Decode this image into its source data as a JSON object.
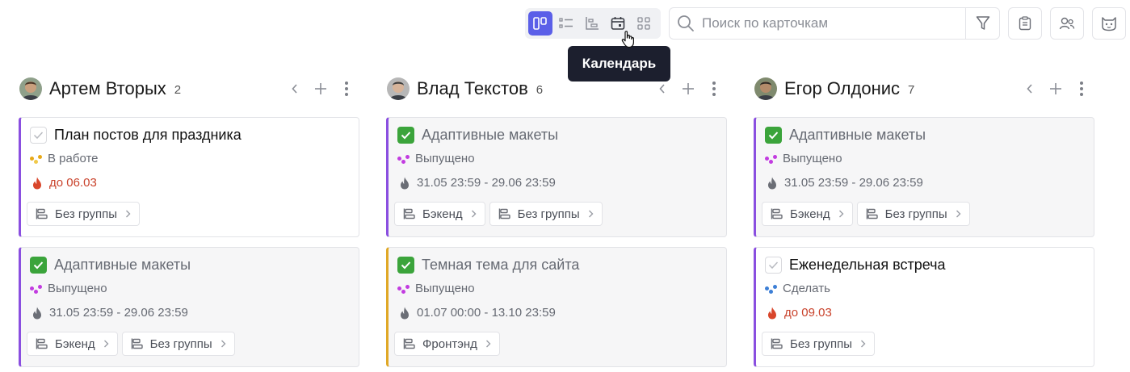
{
  "toolbar": {
    "views": [
      {
        "icon": "board-view-icon",
        "active": true
      },
      {
        "icon": "list-view-icon",
        "active": false
      },
      {
        "icon": "gantt-view-icon",
        "active": false
      },
      {
        "icon": "calendar-view-icon",
        "active": false
      },
      {
        "icon": "grid-view-icon",
        "active": false
      }
    ],
    "search_placeholder": "Поиск по карточкам",
    "tooltip": "Календарь",
    "accent": "#5b5fe8"
  },
  "columns": [
    {
      "name": "Артем Вторых",
      "count": "2",
      "cards": [
        {
          "title": "План постов для праздника",
          "checked": false,
          "status": "В работе",
          "date": "до 06.03",
          "due": true,
          "tags": [
            "Без группы"
          ]
        },
        {
          "title": "Адаптивные макеты",
          "checked": true,
          "status": "Выпущено",
          "date": "31.05 23:59 - 29.06 23:59",
          "due": false,
          "tags": [
            "Бэкенд",
            "Без группы"
          ]
        }
      ]
    },
    {
      "name": "Влад Текстов",
      "count": "6",
      "cards": [
        {
          "title": "Адаптивные макеты",
          "checked": true,
          "status": "Выпущено",
          "date": "31.05 23:59 - 29.06 23:59",
          "due": false,
          "tags": [
            "Бэкенд",
            "Без группы"
          ]
        },
        {
          "title": "Темная тема для сайта",
          "checked": true,
          "status": "Выпущено",
          "date": "01.07 00:00 - 13.10 23:59",
          "due": false,
          "tags": [
            "Фронтэнд"
          ]
        }
      ]
    },
    {
      "name": "Егор Олдонис",
      "count": "7",
      "cards": [
        {
          "title": "Адаптивные макеты",
          "checked": true,
          "status": "Выпущено",
          "date": "31.05 23:59 - 29.06 23:59",
          "due": false,
          "tags": [
            "Бэкенд",
            "Без группы"
          ]
        },
        {
          "title": "Еженедельная встреча",
          "checked": false,
          "status": "Сделать",
          "date": "до 09.03",
          "due": true,
          "tags": [
            "Без группы"
          ]
        }
      ]
    }
  ]
}
